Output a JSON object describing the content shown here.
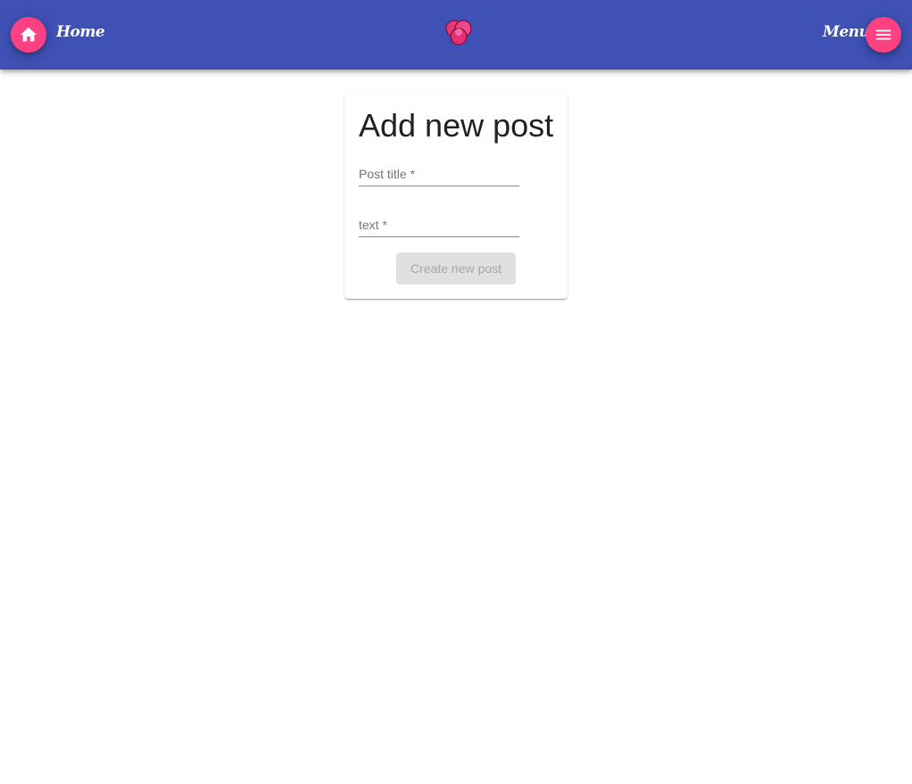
{
  "header": {
    "home_label": "Home",
    "menu_label": "Menu",
    "home_icon": "home-icon",
    "menu_icon": "hamburger-menu-icon",
    "logo_icon": "pink-flower-logo"
  },
  "colors": {
    "appbar": "#3f51b5",
    "accent": "#ff4081",
    "disabled_button_bg": "#e0e0e0",
    "disabled_button_text": "#a6a6a6"
  },
  "form": {
    "title": "Add new post",
    "post_title_label": "Post title *",
    "post_title_value": "",
    "text_label": "text *",
    "text_value": "",
    "submit_label": "Create new post",
    "submit_disabled": true
  }
}
